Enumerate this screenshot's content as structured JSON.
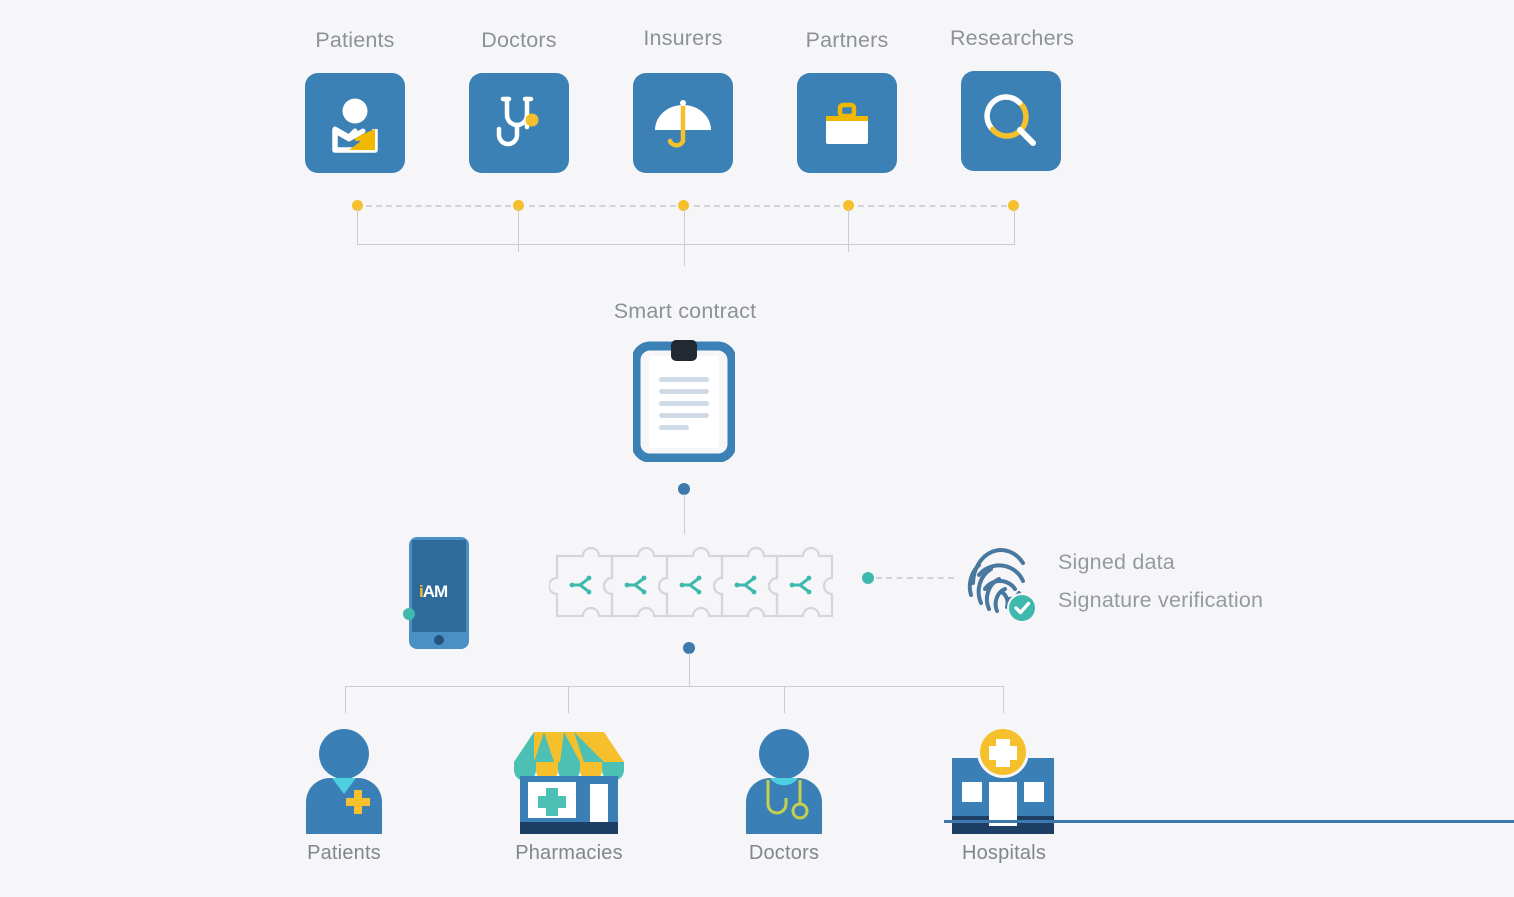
{
  "theme": {
    "background": "#f6f6f8",
    "tile_blue": "#3c81b5",
    "accent_yellow": "#f5c02b",
    "accent_teal": "#3fb9ad",
    "line_gray": "#c9cdd2",
    "text_gray": "#8c939b",
    "deep_blue": "#1d3f66",
    "fingerprint_blue": "#4a7ba8"
  },
  "diagram": {
    "title_smart_contract": "Smart contract",
    "actors_top": [
      {
        "label": "Patients",
        "icon": "person-card-icon"
      },
      {
        "label": "Doctors",
        "icon": "stethoscope-icon"
      },
      {
        "label": "Insurers",
        "icon": "umbrella-icon"
      },
      {
        "label": "Partners",
        "icon": "briefcase-icon"
      },
      {
        "label": "Researchers",
        "icon": "magnifier-icon"
      }
    ],
    "smart_contract": {
      "icon": "clipboard-icon",
      "document_lines": 5
    },
    "mobile_app": {
      "icon": "smartphone-icon",
      "logo_text_accent": "i",
      "logo_text_main": "AM"
    },
    "blockchain": {
      "icon": "puzzle-chain-icon",
      "pieces": 5,
      "piece_symbol": "chain-node-icon"
    },
    "verification": {
      "icon": "fingerprint-icon",
      "badge_icon": "check-circle-icon",
      "lines": [
        "Signed data",
        "Signature verification"
      ]
    },
    "endpoints_bottom": [
      {
        "label": "Patients",
        "icon": "patient-person-icon"
      },
      {
        "label": "Pharmacies",
        "icon": "pharmacy-store-icon"
      },
      {
        "label": "Doctors",
        "icon": "doctor-person-icon"
      },
      {
        "label": "Hospitals",
        "icon": "hospital-building-icon"
      }
    ]
  }
}
